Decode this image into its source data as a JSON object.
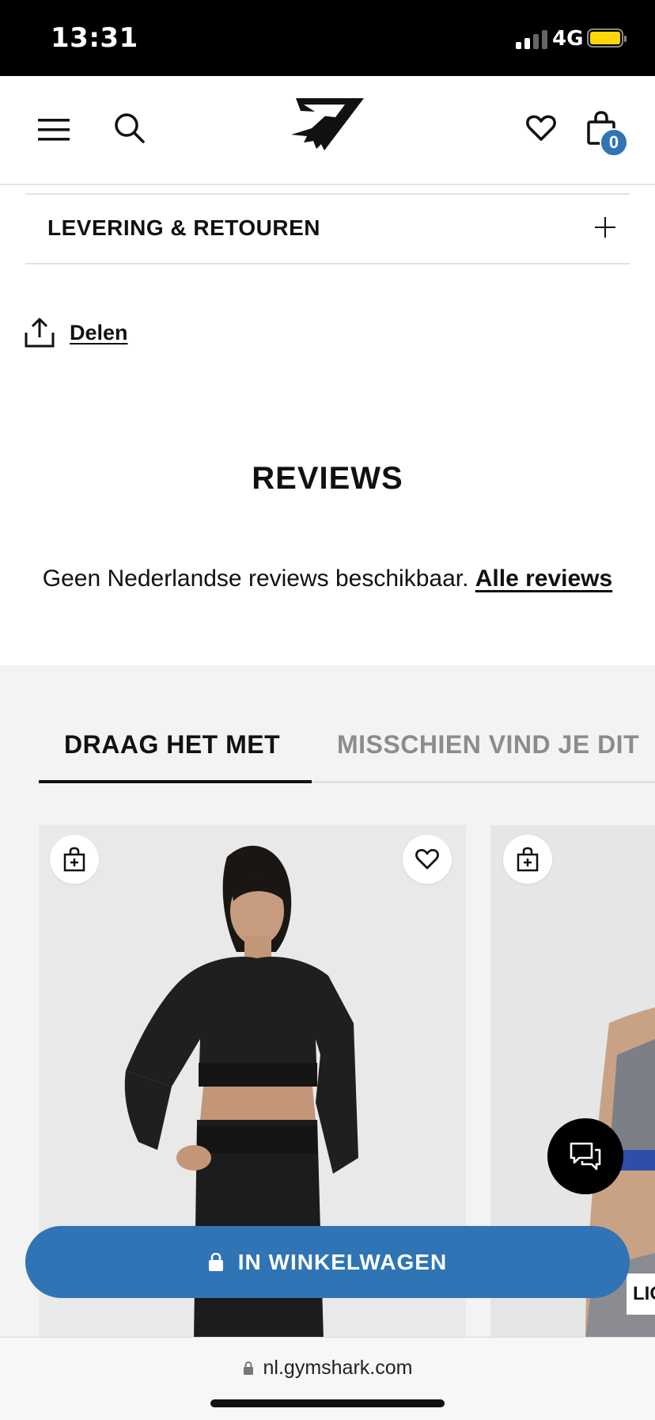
{
  "status_bar": {
    "time": "13:31",
    "network": "4G"
  },
  "header": {
    "cart_count": "0"
  },
  "accordion": {
    "title": "LEVERING & RETOUREN"
  },
  "share": {
    "label": "Delen"
  },
  "reviews": {
    "title": "REVIEWS",
    "text": "Geen Nederlandse reviews beschikbaar.",
    "link": "Alle reviews"
  },
  "recommendations": {
    "tabs": [
      {
        "label": "DRAAG HET MET",
        "active": true
      },
      {
        "label": "MISSCHIEN VIND JE DIT",
        "active": false
      }
    ],
    "products": [
      {
        "image": "woman-black-long-sleeve-crop-top"
      },
      {
        "image": "woman-grey-sports-bra",
        "partial_label": "LIG"
      }
    ]
  },
  "cta": {
    "label": "IN WINKELWAGEN"
  },
  "browser": {
    "url": "nl.gymshark.com"
  },
  "colors": {
    "accent": "#2f74b5",
    "battery": "#ffd60a"
  }
}
